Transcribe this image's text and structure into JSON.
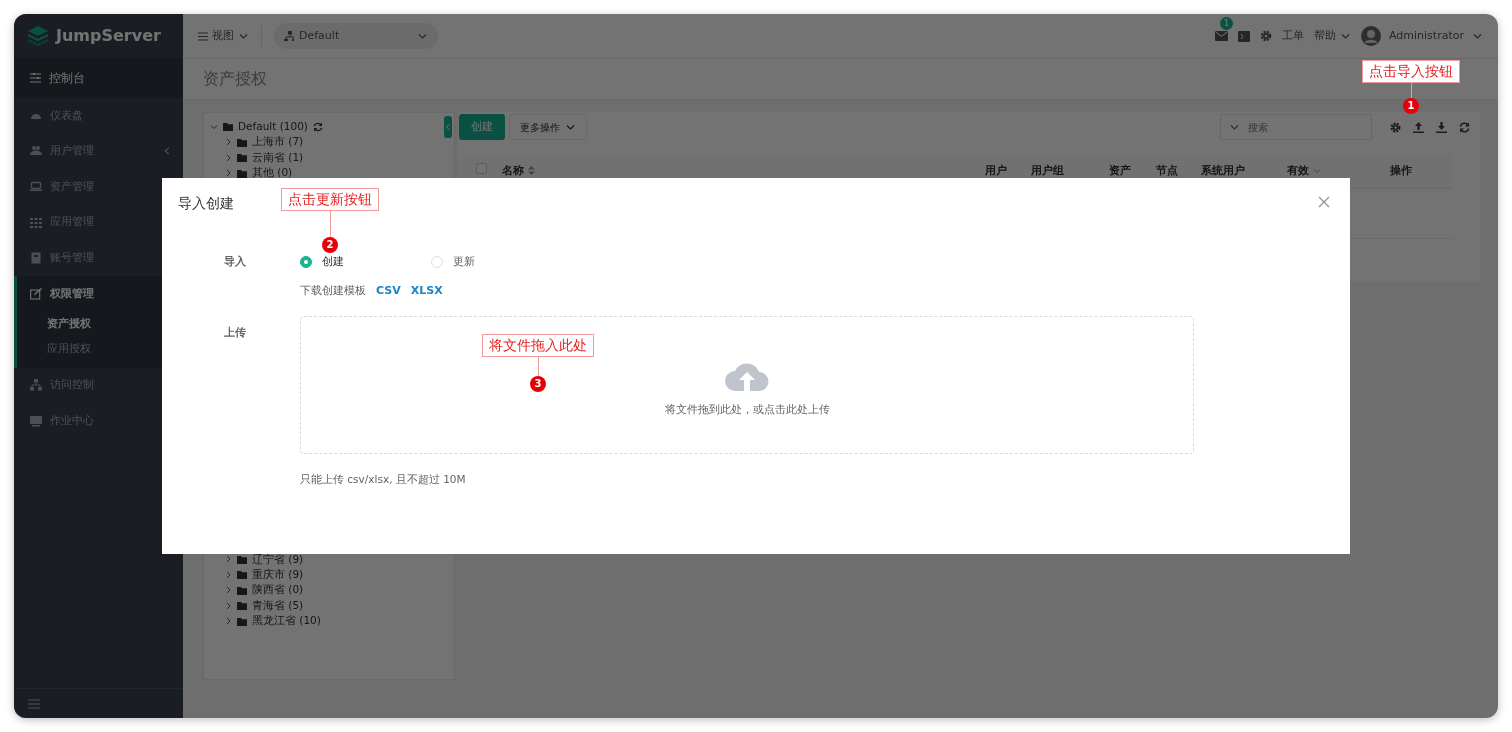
{
  "brand": {
    "name": "JumpServer"
  },
  "sidebar": {
    "title": "控制台",
    "items": [
      {
        "label": "仪表盘",
        "kind": "link",
        "selected": false
      },
      {
        "label": "用户管理",
        "kind": "group",
        "expanded": false,
        "selected": false
      },
      {
        "label": "资产管理",
        "kind": "link",
        "selected": false
      },
      {
        "label": "应用管理",
        "kind": "link",
        "selected": false
      },
      {
        "label": "账号管理",
        "kind": "link",
        "selected": false
      },
      {
        "label": "权限管理",
        "kind": "group",
        "expanded": true,
        "selected": true,
        "children": [
          {
            "label": "资产授权",
            "selected": true
          },
          {
            "label": "应用授权",
            "selected": false
          }
        ]
      },
      {
        "label": "访问控制",
        "kind": "link",
        "selected": false
      },
      {
        "label": "作业中心",
        "kind": "link",
        "selected": false
      }
    ]
  },
  "topbar": {
    "view_menu": "视图",
    "org": "Default",
    "mail_badge": "1",
    "ticket": "工单",
    "help": "帮助",
    "user": "Administrator"
  },
  "page_title": "资产授权",
  "tree": {
    "root": {
      "label": "Default (100)",
      "expanded": true
    },
    "children": [
      {
        "label": "上海市 (7)",
        "expanded": false
      },
      {
        "label": "云南省 (1)",
        "expanded": false
      },
      {
        "label": "其他 (0)",
        "expanded": false
      },
      {
        "label": "辽宁省 (9)",
        "expanded": false
      },
      {
        "label": "重庆市 (9)",
        "expanded": false
      },
      {
        "label": "陕西省 (0)",
        "expanded": false
      },
      {
        "label": "青海省 (5)",
        "expanded": false
      },
      {
        "label": "黑龙江省 (10)",
        "expanded": false
      }
    ]
  },
  "toolbar": {
    "create": "创建",
    "more": "更多操作",
    "search_placeholder": "搜索"
  },
  "table": {
    "select_all": {
      "checked": false
    },
    "columns": [
      {
        "label": "名称",
        "kind": "sort"
      },
      {
        "label": "用户",
        "kind": "plain"
      },
      {
        "label": "用户组",
        "kind": "plain"
      },
      {
        "label": "资产",
        "kind": "plain"
      },
      {
        "label": "节点",
        "kind": "plain"
      },
      {
        "label": "系统用户",
        "kind": "plain"
      },
      {
        "label": "有效",
        "kind": "filter"
      },
      {
        "label": "操作",
        "kind": "plain"
      }
    ]
  },
  "modal": {
    "title": "导入创建",
    "import_label": "导入",
    "options": [
      {
        "label": "创建",
        "selected": true
      },
      {
        "label": "更新",
        "selected": false
      }
    ],
    "template_text": "下载创建模板",
    "template_links": [
      "CSV",
      "XLSX"
    ],
    "upload_label": "上传",
    "drop_text": "将文件拖到此处，或点击此处上传",
    "tip": "只能上传 csv/xlsx, 且不超过 10M"
  },
  "annotations": [
    {
      "number": "1",
      "text": "点击导入按钮"
    },
    {
      "number": "2",
      "text": "点击更新按钮"
    },
    {
      "number": "3",
      "text": "将文件拖入此处"
    }
  ]
}
